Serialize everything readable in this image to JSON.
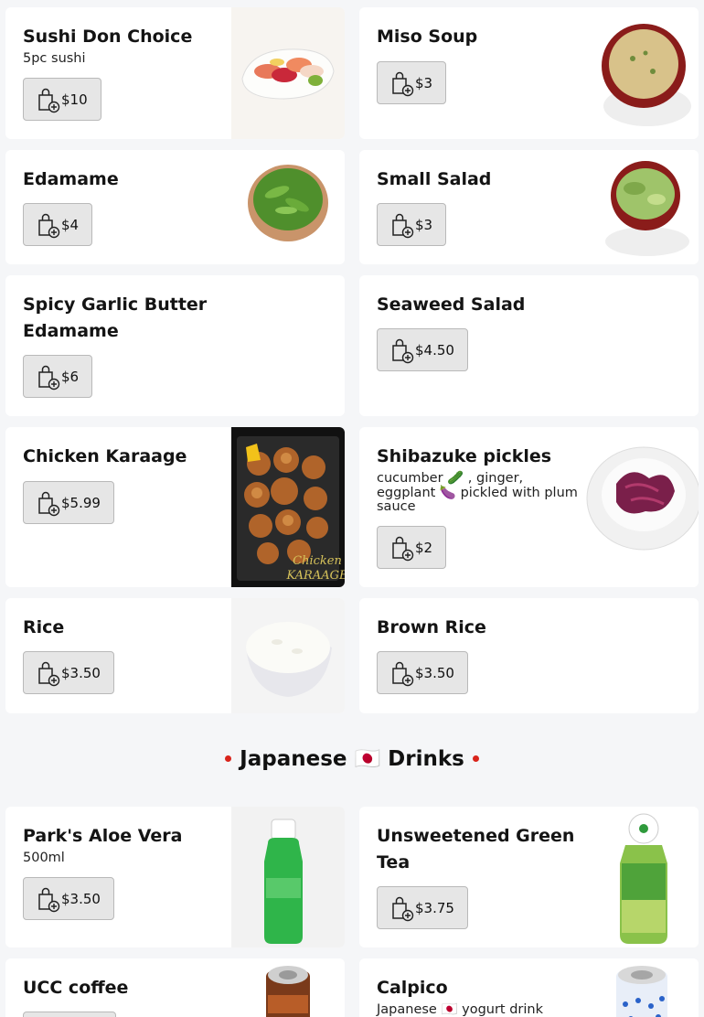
{
  "menu": {
    "items": [
      {
        "title": "Sushi Don Choice",
        "desc": "5pc sushi",
        "price": "$10"
      },
      {
        "title": "Miso Soup",
        "desc": "",
        "price": "$3"
      },
      {
        "title": "Edamame",
        "desc": "",
        "price": "$4"
      },
      {
        "title": "Small Salad",
        "desc": "",
        "price": "$3"
      },
      {
        "title": "Spicy Garlic Butter Edamame",
        "desc": "",
        "price": "$6"
      },
      {
        "title": "Seaweed Salad",
        "desc": "",
        "price": "$4.50"
      },
      {
        "title": "Chicken Karaage",
        "desc": "",
        "price": "$5.99",
        "image_text": "Chicken KARAAGE"
      },
      {
        "title": "Shibazuke pickles",
        "desc": "cucumber 🥒 , ginger, eggplant 🍆 pickled with plum sauce",
        "price": "$2"
      },
      {
        "title": "Rice",
        "desc": "",
        "price": "$3.50"
      },
      {
        "title": "Brown Rice",
        "desc": "",
        "price": "$3.50"
      }
    ]
  },
  "drinks_section": {
    "title": "Japanese 🇯🇵 Drinks"
  },
  "drinks": {
    "items": [
      {
        "title": "Park's Aloe Vera",
        "desc": "500ml",
        "price": "$3.50"
      },
      {
        "title": "Unsweetened Green Tea",
        "desc": "",
        "price": "$3.75"
      },
      {
        "title": "UCC coffee",
        "desc": "",
        "price": ""
      },
      {
        "title": "Calpico",
        "desc": "Japanese 🇯🇵 yogurt drink",
        "price": ""
      }
    ]
  },
  "icons": {
    "cart": "shopping-bag-plus-icon"
  },
  "colors": {
    "accent_dot": "#d9241b",
    "button_bg": "#e6e6e6",
    "card_bg": "#ffffff",
    "page_bg": "#f5f6f8"
  }
}
